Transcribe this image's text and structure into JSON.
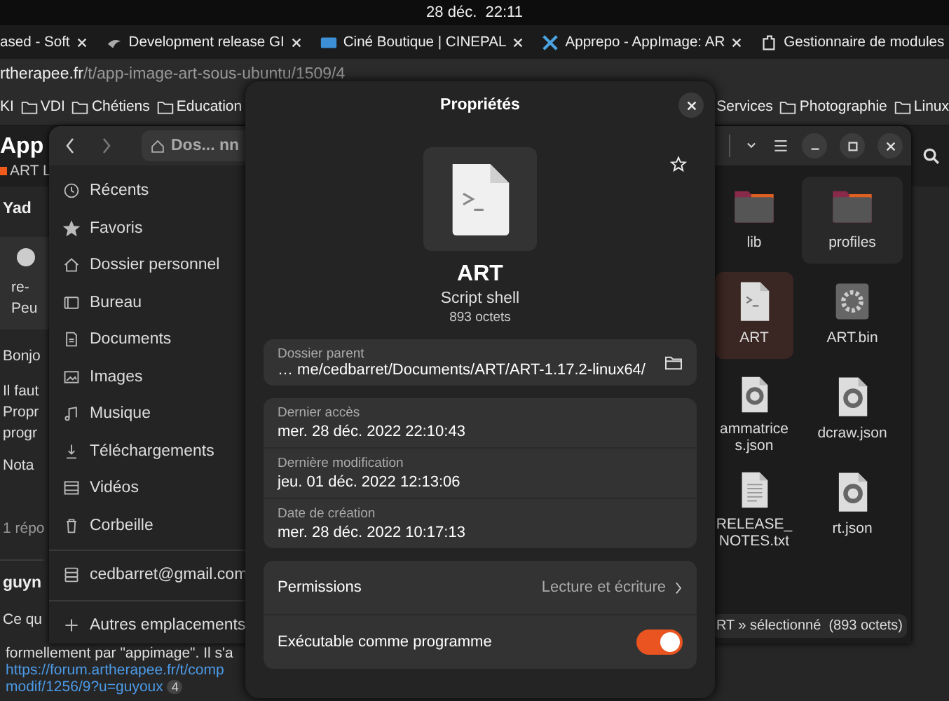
{
  "top_bar": {
    "clock": "28 déc.  22:11"
  },
  "browser": {
    "tabs": [
      {
        "label": "ased - Soft",
        "kind": "plain"
      },
      {
        "label": "Development release GI",
        "kind": "brush"
      },
      {
        "label": "Ciné Boutique | CINEPAL",
        "kind": "screen"
      },
      {
        "label": "Apprepo - AppImage: AR",
        "kind": "tools"
      },
      {
        "label": "Gestionnaire de modules",
        "kind": "puzzle"
      }
    ],
    "url": {
      "host": "rtherapee.fr",
      "path": "/t/app-image-art-sous-ubuntu/1509/4"
    },
    "bookmarks_start": [
      {
        "label": "KI",
        "kind": "plain"
      },
      {
        "label": "VDI",
        "kind": "folder"
      },
      {
        "label": "Chétiens",
        "kind": "folder"
      },
      {
        "label": "Education",
        "kind": "folder"
      }
    ],
    "bookmarks_end": [
      {
        "label": "Services",
        "kind": "plain"
      },
      {
        "label": "Photographie",
        "kind": "folder"
      },
      {
        "label": "Linux",
        "kind": "folder"
      }
    ],
    "page": {
      "title": "App",
      "category": "ART L",
      "author": "Yad",
      "quote": [
        "re-",
        "Peu"
      ],
      "lines": [
        "Bonjo",
        "Il faut",
        "Propr",
        "progr",
        "Nota"
      ],
      "replies": "1 répo",
      "author_2": "guyn",
      "line_2": "Ce qu",
      "line_3": "formellement par \"appimage\". Il s'a",
      "link": "https://forum.artherapee.fr/t/comp",
      "link_2": "modif/1256/9?u=guyoux",
      "link_badge": "4"
    }
  },
  "file_manager": {
    "path": "Dos... nn",
    "sidebar": [
      {
        "label": "Récents"
      },
      {
        "label": "Favoris"
      },
      {
        "label": "Dossier personnel"
      },
      {
        "label": "Bureau"
      },
      {
        "label": "Documents"
      },
      {
        "label": "Images"
      },
      {
        "label": "Musique"
      },
      {
        "label": "Téléchargements"
      },
      {
        "label": "Vidéos"
      },
      {
        "label": "Corbeille"
      }
    ],
    "account": "cedbarret@gmail.com",
    "other_locations": "Autres emplacements",
    "files": [
      {
        "name": "lib",
        "kind": "folder",
        "selected": false,
        "hovered": false
      },
      {
        "name": "profiles",
        "kind": "folder",
        "selected": false,
        "hovered": true
      },
      {
        "name": "ART",
        "kind": "script",
        "selected": true,
        "hovered": false
      },
      {
        "name": "ART.bin",
        "kind": "binary",
        "selected": false,
        "hovered": false
      },
      {
        "name": "ammatrices.json",
        "kind": "json",
        "selected": false,
        "hovered": false
      },
      {
        "name": "dcraw.json",
        "kind": "json",
        "selected": false,
        "hovered": false
      },
      {
        "name": "RELEASE_NOTES.txt",
        "kind": "text",
        "selected": false,
        "hovered": false
      },
      {
        "name": "rt.json",
        "kind": "json",
        "selected": false,
        "hovered": false
      }
    ],
    "status": "RT » sélectionné  (893 octets)"
  },
  "dialog": {
    "title": "Propriétés",
    "name": "ART",
    "type": "Script shell",
    "size": "893 octets",
    "parent": {
      "label": "Dossier parent",
      "value": "… me/cedbarret/Documents/ART/ART-1.17.2-linux64/"
    },
    "dates": [
      {
        "label": "Dernier accès",
        "value": "mer. 28 déc. 2022 22:10:43"
      },
      {
        "label": "Dernière modification",
        "value": "jeu. 01 déc. 2022 12:13:06"
      },
      {
        "label": "Date de création",
        "value": "mer. 28 déc. 2022 10:17:13"
      }
    ],
    "permissions": {
      "label": "Permissions",
      "value": "Lecture et écriture"
    },
    "executable": {
      "label": "Exécutable comme programme",
      "on": true
    }
  }
}
